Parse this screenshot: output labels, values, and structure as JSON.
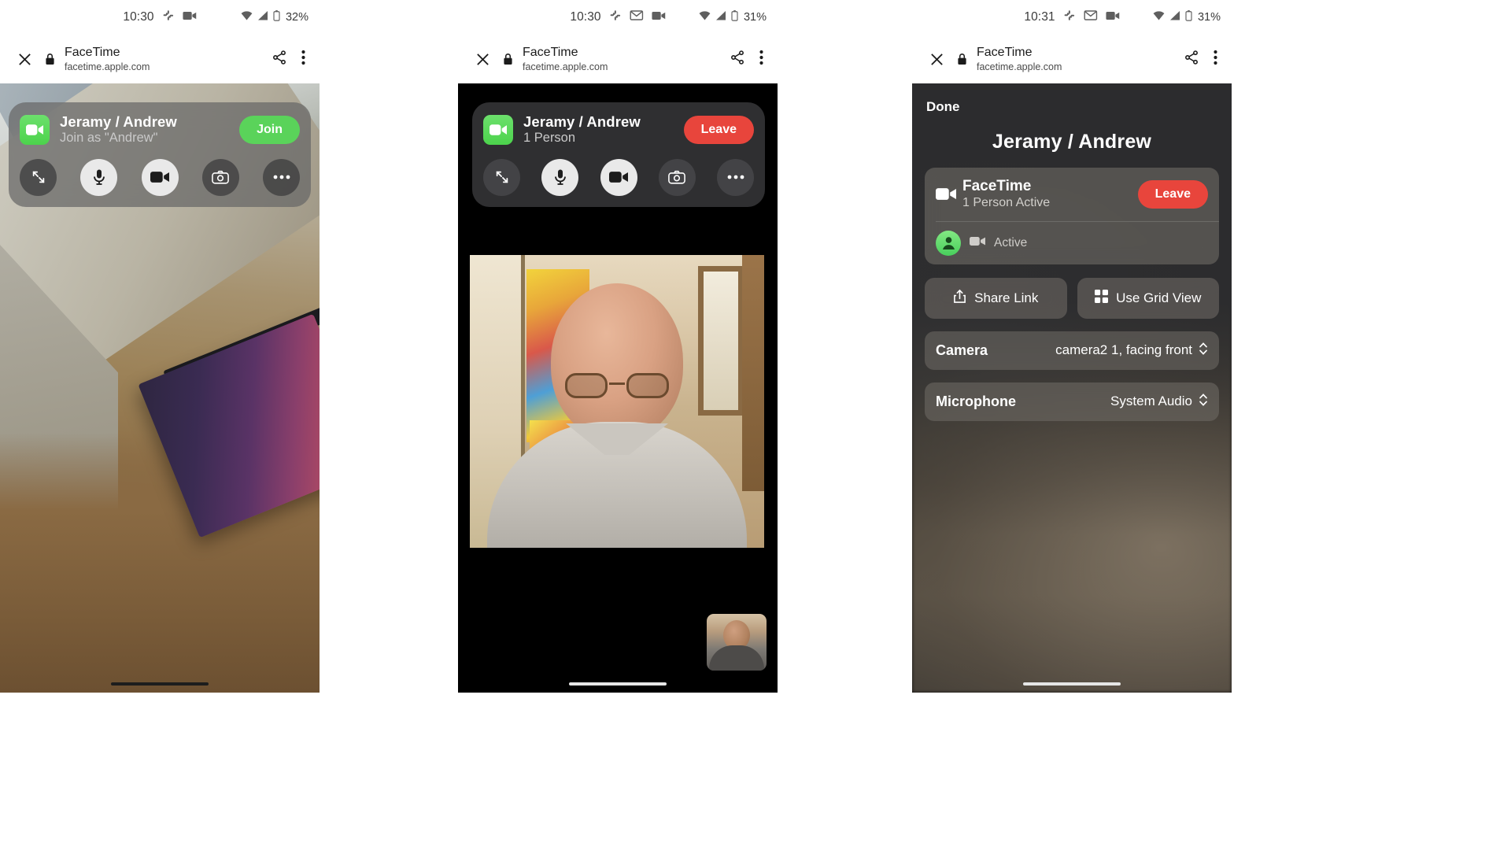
{
  "panels": [
    {
      "id": "join-screen",
      "status": {
        "time": "10:30",
        "battery": "32%",
        "icons": [
          "slack-icon",
          "video-recording-icon",
          "wifi-icon",
          "cell-signal-icon",
          "battery-icon"
        ]
      },
      "browser": {
        "title": "FaceTime",
        "url": "facetime.apple.com",
        "close_label": "✕",
        "icons": [
          "close-icon",
          "lock-icon",
          "share-icon",
          "overflow-menu-icon"
        ]
      },
      "call": {
        "title": "Jeramy / Andrew",
        "subtitle": "Join as \"Andrew\"",
        "action_label": "Join",
        "action_kind": "join",
        "controls": [
          "expand-icon",
          "microphone-icon",
          "video-camera-icon",
          "flip-camera-icon",
          "more-options-icon"
        ]
      }
    },
    {
      "id": "in-call-screen",
      "status": {
        "time": "10:30",
        "battery": "31%",
        "icons": [
          "slack-icon",
          "gmail-icon",
          "video-recording-icon",
          "wifi-icon",
          "cell-signal-icon",
          "battery-icon"
        ]
      },
      "browser": {
        "title": "FaceTime",
        "url": "facetime.apple.com",
        "close_label": "✕",
        "icons": [
          "close-icon",
          "lock-icon",
          "share-icon",
          "overflow-menu-icon"
        ]
      },
      "call": {
        "title": "Jeramy / Andrew",
        "subtitle": "1 Person",
        "action_label": "Leave",
        "action_kind": "leave",
        "controls": [
          "expand-icon",
          "microphone-icon",
          "video-camera-icon",
          "flip-camera-icon",
          "more-options-icon"
        ]
      }
    },
    {
      "id": "call-details-sheet",
      "status": {
        "time": "10:31",
        "battery": "31%",
        "icons": [
          "slack-icon",
          "gmail-icon",
          "video-recording-icon",
          "wifi-icon",
          "cell-signal-icon",
          "battery-icon"
        ]
      },
      "browser": {
        "title": "FaceTime",
        "url": "facetime.apple.com",
        "close_label": "✕",
        "icons": [
          "close-icon",
          "lock-icon",
          "share-icon",
          "overflow-menu-icon"
        ]
      },
      "sheet": {
        "done_label": "Done",
        "title": "Jeramy / Andrew",
        "call_card": {
          "name": "FaceTime",
          "status": "1 Person Active",
          "leave_label": "Leave",
          "participant_status": "Active"
        },
        "actions": [
          {
            "label": "Share Link",
            "icon": "share-link-icon"
          },
          {
            "label": "Use Grid View",
            "icon": "grid-view-icon"
          }
        ],
        "settings": [
          {
            "label": "Camera",
            "value": "camera2 1, facing front"
          },
          {
            "label": "Microphone",
            "value": "System Audio"
          }
        ]
      }
    }
  ],
  "colors": {
    "join_green": "#5ad35a",
    "leave_red": "#e8453c",
    "facetime_green": "#4cd34c",
    "sheet_bg": "#2c2c2e"
  }
}
